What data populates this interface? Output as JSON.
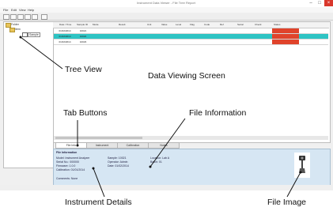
{
  "window": {
    "title": "Instrument Data Viewer - File Tree Report",
    "close_glyph": "×",
    "maximize_glyph": "□",
    "minimize_glyph": "–"
  },
  "menu": [
    "File",
    "Edit",
    "View",
    "Help"
  ],
  "tree": {
    "root": "Folder",
    "child": "Item",
    "file": "Sample"
  },
  "grid": {
    "headers": [
      "Date / Time",
      "Sample ID",
      "Mode",
      "Result",
      "Unit",
      "Value",
      "Level",
      "Flag",
      "Code",
      "Ref",
      "Serial",
      "Check",
      "Status"
    ],
    "rows": [
      {
        "date": "01/02/2014",
        "id": "10021",
        "status": ""
      },
      {
        "date": "01/02/2014",
        "id": "10022",
        "status": ""
      },
      {
        "date": "01/02/2014",
        "id": "10023",
        "status": ""
      }
    ]
  },
  "tabs": [
    "File Info",
    "Instrument",
    "Calibration",
    "Notes"
  ],
  "info_panel": {
    "heading": "File Information",
    "instrument_lines": [
      "Model: Instrument Analyzer",
      "Serial No.: 000000",
      "Firmware: 1.0.0",
      "Calibration: 01/01/2014"
    ],
    "file_lines": [
      "Sample: 10021",
      "Operator: Admin",
      "Date: 01/02/2014"
    ],
    "extra_lines": [
      "Location: Lab A",
      "Batch: 01"
    ],
    "footer_lines": [
      "Comments: None"
    ]
  },
  "callouts": {
    "tree_view": "Tree View",
    "data_viewing_screen": "Data Viewing Screen",
    "tab_buttons": "Tab Buttons",
    "file_information": "File Information",
    "instrument_details": "Instrument Details",
    "file_image": "File Image"
  },
  "colors": {
    "selected_row": "#2ec4c4",
    "status_red": "#e0432b",
    "info_panel": "#d6e6f3",
    "close_button": "#d9372b"
  }
}
